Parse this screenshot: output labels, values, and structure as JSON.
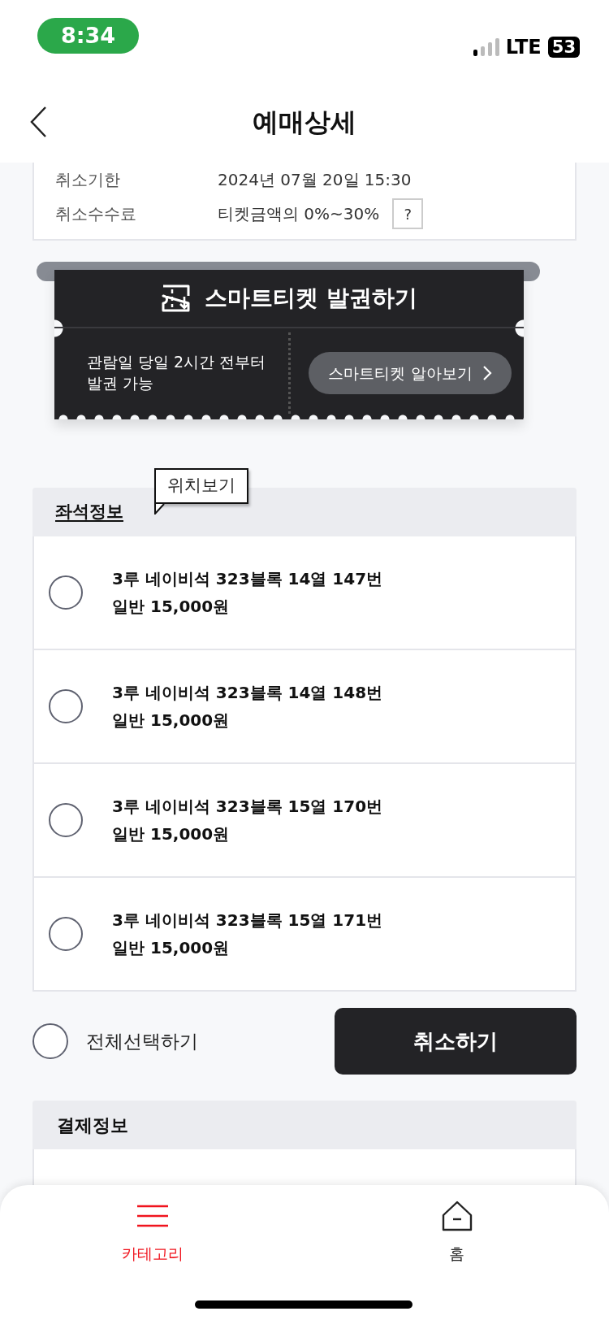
{
  "status_bar": {
    "time": "8:34",
    "network": "LTE",
    "battery": "53"
  },
  "header": {
    "title": "예매상세"
  },
  "cancel_info": [
    {
      "label": "취소기한",
      "value": "2024년 07월 20일 15:30"
    },
    {
      "label": "취소수수료",
      "value": "티켓금액의 0%~30%",
      "help": "?"
    }
  ],
  "smart_ticket": {
    "title": "스마트티켓 발권하기",
    "note": "관람일 당일 2시간 전부터\n발권 가능",
    "button": "스마트티켓 알아보기"
  },
  "seat_info": {
    "title": "좌석정보",
    "tooltip": "위치보기",
    "seats": [
      {
        "seat": "3루 네이비석 323블록 14열 147번",
        "price": "일반 15,000원",
        "selected": false
      },
      {
        "seat": "3루 네이비석 323블록 14열 148번",
        "price": "일반 15,000원",
        "selected": false
      },
      {
        "seat": "3루 네이비석 323블록 15열 170번",
        "price": "일반 15,000원",
        "selected": false
      },
      {
        "seat": "3루 네이비석 323블록 15열 171번",
        "price": "일반 15,000원",
        "selected": false
      }
    ]
  },
  "select_all": {
    "label": "전체선택하기",
    "checked": false
  },
  "cancel_button": "취소하기",
  "payment_info": {
    "title": "결제정보"
  },
  "bottom_nav": [
    {
      "label": "카테고리",
      "kind": "menu",
      "selected": true
    },
    {
      "label": "홈",
      "kind": "home",
      "selected": false
    }
  ]
}
